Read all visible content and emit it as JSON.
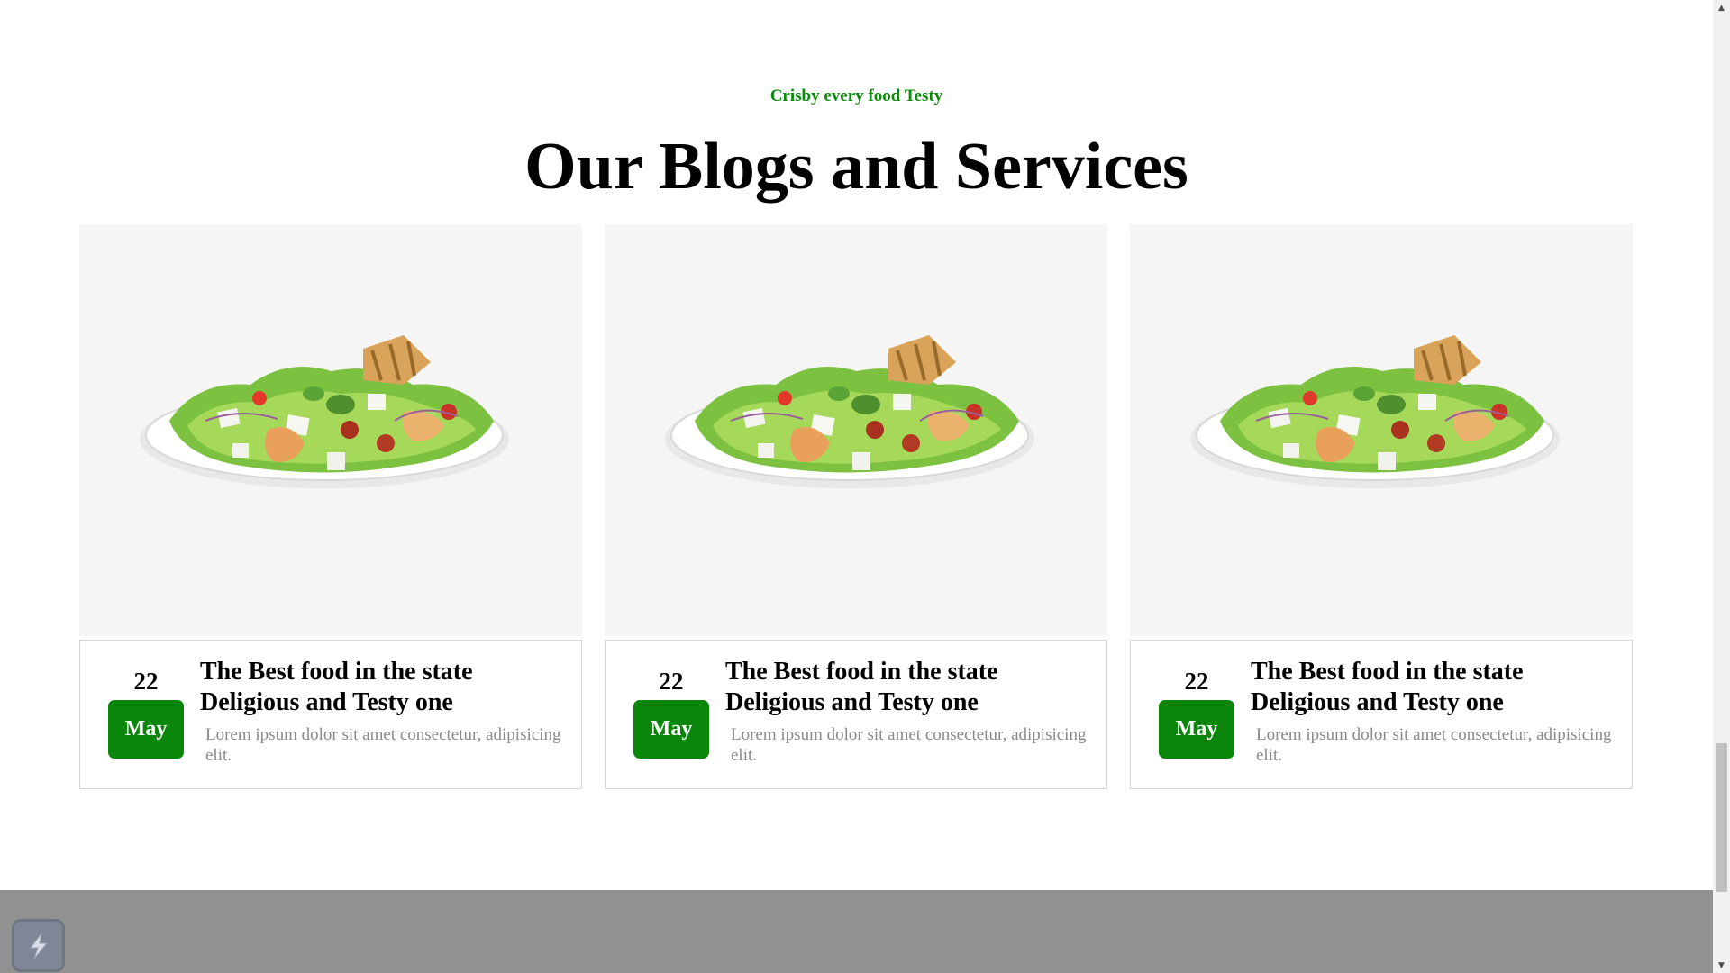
{
  "section": {
    "kicker": "Crisby every food Testy",
    "title": "Our Blogs and Services"
  },
  "cards": [
    {
      "image_icon": "salad-plate-image",
      "day": "22",
      "month": "May",
      "title_line1": "The Best food in the state",
      "title_line2": "Deligious and Testy one",
      "text": "Lorem ipsum dolor sit amet consectetur, adipisicing elit."
    },
    {
      "image_icon": "salad-plate-image",
      "day": "22",
      "month": "May",
      "title_line1": "The Best food in the state",
      "title_line2": "Deligious and Testy one",
      "text": "Lorem ipsum dolor sit amet consectetur, adipisicing elit."
    },
    {
      "image_icon": "salad-plate-image",
      "day": "22",
      "month": "May",
      "title_line1": "The Best food in the state",
      "title_line2": "Deligious and Testy one",
      "text": "Lorem ipsum dolor sit amet consectetur, adipisicing elit."
    }
  ],
  "colors": {
    "accent_green": "#0a870a",
    "kicker_green": "#0a8a0a",
    "image_bg": "#f5f5f5",
    "footer_gray": "#919191",
    "muted_text": "#8a8a8a"
  },
  "widget": {
    "icon": "lightning-bolt-icon"
  },
  "scrollbar": {
    "up_icon": "scroll-up-arrow-icon",
    "down_icon": "scroll-down-arrow-icon"
  }
}
